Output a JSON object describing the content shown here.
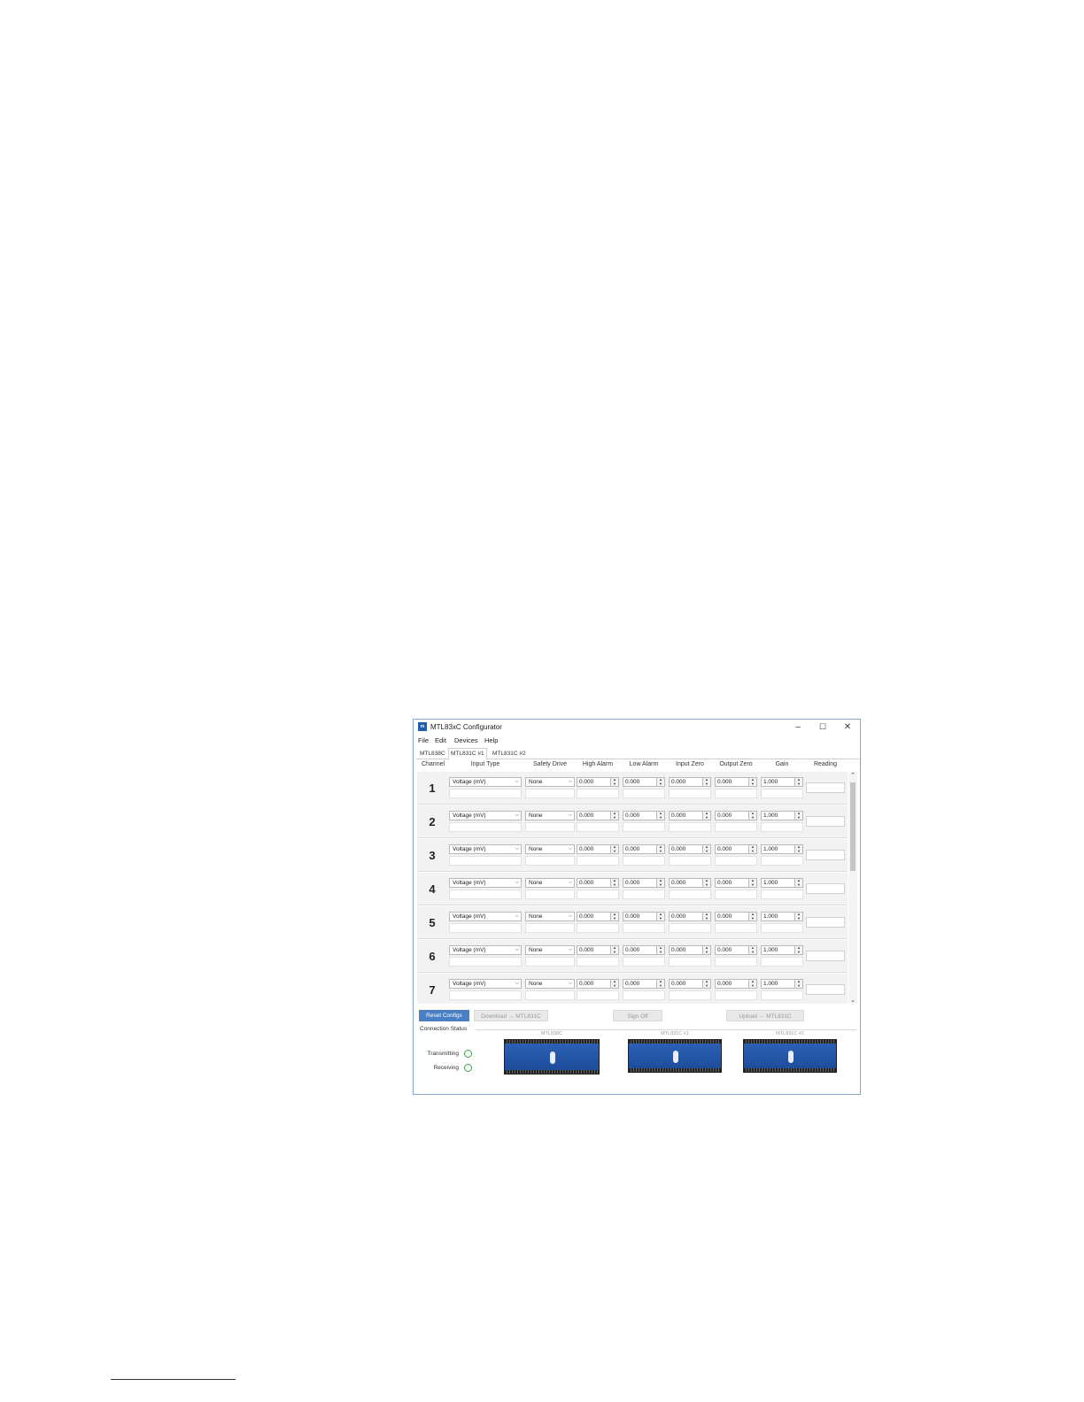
{
  "window": {
    "title": "MTL83xC Configurator",
    "icon_text": "m",
    "controls": {
      "minimize": "–",
      "maximize": "☐",
      "close": "✕"
    }
  },
  "menu": [
    "File",
    "Edit",
    "Devices",
    "Help"
  ],
  "tabs": [
    {
      "label": "MTL838C",
      "active": false
    },
    {
      "label": "MTL831C #1",
      "active": true
    },
    {
      "label": "MTL831C #2",
      "active": false
    }
  ],
  "columns": [
    "Channel",
    "Input Type",
    "Safety Drive",
    "High Alarm",
    "Low Alarm",
    "Input Zero",
    "Output Zero",
    "Gain",
    "Reading"
  ],
  "channels": [
    {
      "number": "1",
      "input_type": "Voltage (mV)",
      "safety_drive": "None",
      "high_alarm": "0.000",
      "low_alarm": "0.000",
      "input_zero": "0.000",
      "output_zero": "0.000",
      "gain": "1.000"
    },
    {
      "number": "2",
      "input_type": "Voltage (mV)",
      "safety_drive": "None",
      "high_alarm": "0.000",
      "low_alarm": "0.000",
      "input_zero": "0.000",
      "output_zero": "0.000",
      "gain": "1.000"
    },
    {
      "number": "3",
      "input_type": "Voltage (mV)",
      "safety_drive": "None",
      "high_alarm": "0.000",
      "low_alarm": "0.000",
      "input_zero": "0.000",
      "output_zero": "0.000",
      "gain": "1.000"
    },
    {
      "number": "4",
      "input_type": "Voltage (mV)",
      "safety_drive": "None",
      "high_alarm": "0.000",
      "low_alarm": "0.000",
      "input_zero": "0.000",
      "output_zero": "0.000",
      "gain": "1.000"
    },
    {
      "number": "5",
      "input_type": "Voltage (mV)",
      "safety_drive": "None",
      "high_alarm": "0.000",
      "low_alarm": "0.000",
      "input_zero": "0.000",
      "output_zero": "0.000",
      "gain": "1.000"
    },
    {
      "number": "6",
      "input_type": "Voltage (mV)",
      "safety_drive": "None",
      "high_alarm": "0.000",
      "low_alarm": "0.000",
      "input_zero": "0.000",
      "output_zero": "0.000",
      "gain": "1.000"
    },
    {
      "number": "7",
      "input_type": "Voltage (mV)",
      "safety_drive": "None",
      "high_alarm": "0.000",
      "low_alarm": "0.000",
      "input_zero": "0.000",
      "output_zero": "0.000",
      "gain": "1.000"
    }
  ],
  "buttons": {
    "reset": "Reset Configs",
    "download": "Download → MTL831C",
    "sign_off": "Sign Off",
    "upload": "Upload ← MTL831C"
  },
  "connection": {
    "title": "Connection Status",
    "transmitting": "Transmitting",
    "receiving": "Receiving",
    "led_color": "#3c9a3c"
  },
  "devices": [
    "MTL838C",
    "MTL831C #1",
    "MTL831C #2"
  ],
  "colors": {
    "accent": "#4a7fc3",
    "window_border": "#7fa7d6",
    "device_blue": "#2f63b8"
  }
}
